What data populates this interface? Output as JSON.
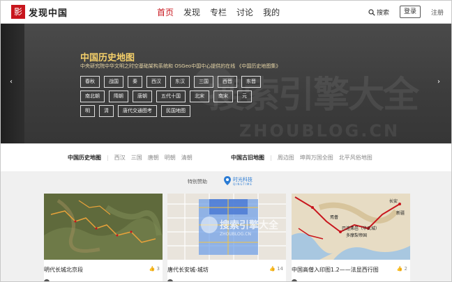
{
  "header": {
    "logo_mark": "影",
    "site_name": "发现中国",
    "nav": [
      {
        "label": "首页",
        "active": true
      },
      {
        "label": "发现",
        "active": false
      },
      {
        "label": "专栏",
        "active": false
      },
      {
        "label": "讨论",
        "active": false
      },
      {
        "label": "我的",
        "active": false
      }
    ],
    "search_label": "搜索",
    "login_label": "登录",
    "register_label": "注册"
  },
  "banner": {
    "title": "中国历史地图",
    "description": "中央研究院中华文明之时空基础架构系统和 OSGeo中国中心提供的在线 《中国历史地图集》",
    "tags": [
      "春秋",
      "战国",
      "秦",
      "西汉",
      "东汉",
      "三国",
      "西晋",
      "东晋",
      "南北朝",
      "隋朝",
      "唐朝",
      "五代十国",
      "北宋",
      "南宋",
      "元",
      "明",
      "清",
      "唐代交通图考",
      "民国地图"
    ],
    "watermark_text": "搜索引擎大全",
    "watermark_url": "ZHOUBLOG.CN",
    "arrow_left": "‹",
    "arrow_right": "›"
  },
  "categories": {
    "group1": {
      "head": "中国历史地图",
      "links": [
        "西汉",
        "三国",
        "唐朝",
        "明朝",
        "清朝"
      ]
    },
    "group2": {
      "head": "中国古旧地图",
      "links": [
        "周边图",
        "坤舆万国全图",
        "北平风俗地图"
      ]
    }
  },
  "sponsor": {
    "label": "特别赞助",
    "name": "时光科技",
    "sub": "QINGTIME"
  },
  "cards": [
    {
      "title": "明代长城北京段",
      "count": "3"
    },
    {
      "title": "唐代长安城-城坊",
      "count": "14"
    },
    {
      "title": "中国高僧入印图1.2——法显西行图",
      "count": "2"
    }
  ],
  "map_labels": {
    "card3": [
      "长安",
      "新疆",
      "焉耆",
      "巴连弗邑（华氏城）",
      "多摩梨帝国"
    ]
  },
  "colors": {
    "brand_red": "#c8161d",
    "banner_title": "#f5d06a",
    "sponsor_blue": "#2a7bd4"
  }
}
